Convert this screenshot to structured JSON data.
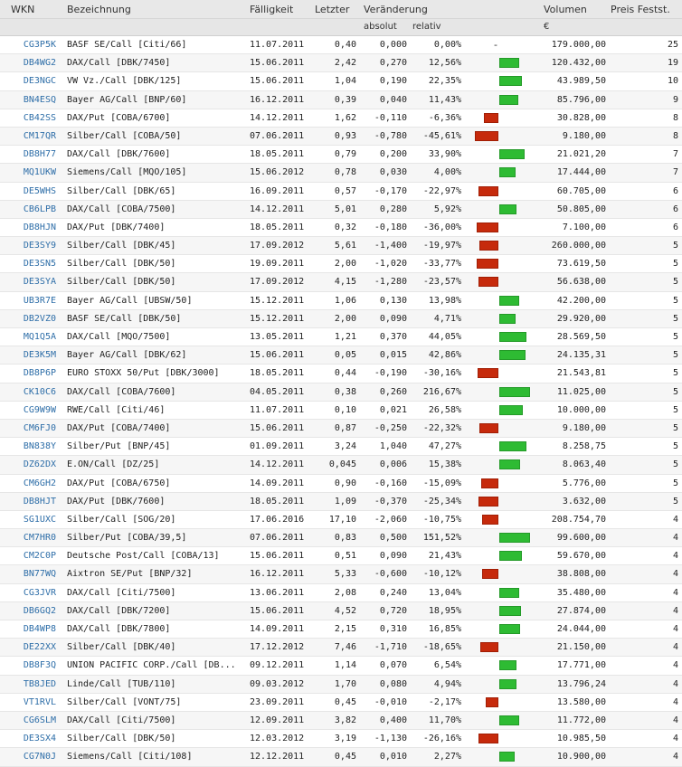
{
  "columns": {
    "wkn": "WKN",
    "bezeichnung": "Bezeichnung",
    "faelligkeit": "Fälligkeit",
    "letzter": "Letzter",
    "veraenderung": "Veränderung",
    "volumen": "Volumen",
    "preis": "Preis Festst.",
    "absolut": "absolut",
    "relativ": "relativ",
    "currency": "€"
  },
  "colors": {
    "positive": "#2ebb33",
    "negative": "#c62a0c",
    "link": "#2e6ea8"
  },
  "rows": [
    {
      "wkn": "CG3P5K",
      "bez": "BASF SE/Call [Citi/66]",
      "date": "11.07.2011",
      "last": "0,40",
      "abs": "0,000",
      "rel": "0,00%",
      "pct": 0.0,
      "vol": "179.000,00",
      "pre": "25"
    },
    {
      "wkn": "DB4WG2",
      "bez": "DAX/Call [DBK/7450]",
      "date": "15.06.2011",
      "last": "2,42",
      "abs": "0,270",
      "rel": "12,56%",
      "pct": 12.56,
      "vol": "120.432,00",
      "pre": "19"
    },
    {
      "wkn": "DE3NGC",
      "bez": "VW Vz./Call [DBK/125]",
      "date": "15.06.2011",
      "last": "1,04",
      "abs": "0,190",
      "rel": "22,35%",
      "pct": 22.35,
      "vol": "43.989,50",
      "pre": "10"
    },
    {
      "wkn": "BN4ESQ",
      "bez": "Bayer AG/Call [BNP/60]",
      "date": "16.12.2011",
      "last": "0,39",
      "abs": "0,040",
      "rel": "11,43%",
      "pct": 11.43,
      "vol": "85.796,00",
      "pre": "9"
    },
    {
      "wkn": "CB42SS",
      "bez": "DAX/Put [COBA/6700]",
      "date": "14.12.2011",
      "last": "1,62",
      "abs": "-0,110",
      "rel": "-6,36%",
      "pct": -6.36,
      "vol": "30.828,00",
      "pre": "8"
    },
    {
      "wkn": "CM17QR",
      "bez": "Silber/Call [COBA/50]",
      "date": "07.06.2011",
      "last": "0,93",
      "abs": "-0,780",
      "rel": "-45,61%",
      "pct": -45.61,
      "vol": "9.180,00",
      "pre": "8"
    },
    {
      "wkn": "DB8H77",
      "bez": "DAX/Call [DBK/7600]",
      "date": "18.05.2011",
      "last": "0,79",
      "abs": "0,200",
      "rel": "33,90%",
      "pct": 33.9,
      "vol": "21.021,20",
      "pre": "7"
    },
    {
      "wkn": "MQ1UKW",
      "bez": "Siemens/Call [MQO/105]",
      "date": "15.06.2012",
      "last": "0,78",
      "abs": "0,030",
      "rel": "4,00%",
      "pct": 4.0,
      "vol": "17.444,00",
      "pre": "7"
    },
    {
      "wkn": "DE5WHS",
      "bez": "Silber/Call [DBK/65]",
      "date": "16.09.2011",
      "last": "0,57",
      "abs": "-0,170",
      "rel": "-22,97%",
      "pct": -22.97,
      "vol": "60.705,00",
      "pre": "6"
    },
    {
      "wkn": "CB6LPB",
      "bez": "DAX/Call [COBA/7500]",
      "date": "14.12.2011",
      "last": "5,01",
      "abs": "0,280",
      "rel": "5,92%",
      "pct": 5.92,
      "vol": "50.805,00",
      "pre": "6"
    },
    {
      "wkn": "DB8HJN",
      "bez": "DAX/Put [DBK/7400]",
      "date": "18.05.2011",
      "last": "0,32",
      "abs": "-0,180",
      "rel": "-36,00%",
      "pct": -36.0,
      "vol": "7.100,00",
      "pre": "6"
    },
    {
      "wkn": "DE3SY9",
      "bez": "Silber/Call [DBK/45]",
      "date": "17.09.2012",
      "last": "5,61",
      "abs": "-1,400",
      "rel": "-19,97%",
      "pct": -19.97,
      "vol": "260.000,00",
      "pre": "5"
    },
    {
      "wkn": "DE3SN5",
      "bez": "Silber/Call [DBK/50]",
      "date": "19.09.2011",
      "last": "2,00",
      "abs": "-1,020",
      "rel": "-33,77%",
      "pct": -33.77,
      "vol": "73.619,50",
      "pre": "5"
    },
    {
      "wkn": "DE3SYA",
      "bez": "Silber/Call [DBK/50]",
      "date": "17.09.2012",
      "last": "4,15",
      "abs": "-1,280",
      "rel": "-23,57%",
      "pct": -23.57,
      "vol": "56.638,00",
      "pre": "5"
    },
    {
      "wkn": "UB3R7E",
      "bez": "Bayer AG/Call [UBSW/50]",
      "date": "15.12.2011",
      "last": "1,06",
      "abs": "0,130",
      "rel": "13,98%",
      "pct": 13.98,
      "vol": "42.200,00",
      "pre": "5"
    },
    {
      "wkn": "DB2VZ0",
      "bez": "BASF SE/Call [DBK/50]",
      "date": "15.12.2011",
      "last": "2,00",
      "abs": "0,090",
      "rel": "4,71%",
      "pct": 4.71,
      "vol": "29.920,00",
      "pre": "5"
    },
    {
      "wkn": "MQ1Q5A",
      "bez": "DAX/Call [MQO/7500]",
      "date": "13.05.2011",
      "last": "1,21",
      "abs": "0,370",
      "rel": "44,05%",
      "pct": 44.05,
      "vol": "28.569,50",
      "pre": "5"
    },
    {
      "wkn": "DE3K5M",
      "bez": "Bayer AG/Call [DBK/62]",
      "date": "15.06.2011",
      "last": "0,05",
      "abs": "0,015",
      "rel": "42,86%",
      "pct": 42.86,
      "vol": "24.135,31",
      "pre": "5"
    },
    {
      "wkn": "DB8P6P",
      "bez": "EURO STOXX 50/Put [DBK/3000]",
      "date": "18.05.2011",
      "last": "0,44",
      "abs": "-0,190",
      "rel": "-30,16%",
      "pct": -30.16,
      "vol": "21.543,81",
      "pre": "5"
    },
    {
      "wkn": "CK10C6",
      "bez": "DAX/Call [COBA/7600]",
      "date": "04.05.2011",
      "last": "0,38",
      "abs": "0,260",
      "rel": "216,67%",
      "pct": 216.67,
      "vol": "11.025,00",
      "pre": "5"
    },
    {
      "wkn": "CG9W9W",
      "bez": "RWE/Call [Citi/46]",
      "date": "11.07.2011",
      "last": "0,10",
      "abs": "0,021",
      "rel": "26,58%",
      "pct": 26.58,
      "vol": "10.000,00",
      "pre": "5"
    },
    {
      "wkn": "CM6FJ0",
      "bez": "DAX/Put [COBA/7400]",
      "date": "15.06.2011",
      "last": "0,87",
      "abs": "-0,250",
      "rel": "-22,32%",
      "pct": -22.32,
      "vol": "9.180,00",
      "pre": "5"
    },
    {
      "wkn": "BN838Y",
      "bez": "Silber/Put [BNP/45]",
      "date": "01.09.2011",
      "last": "3,24",
      "abs": "1,040",
      "rel": "47,27%",
      "pct": 47.27,
      "vol": "8.258,75",
      "pre": "5"
    },
    {
      "wkn": "DZ62DX",
      "bez": "E.ON/Call [DZ/25]",
      "date": "14.12.2011",
      "last": "0,045",
      "abs": "0,006",
      "rel": "15,38%",
      "pct": 15.38,
      "vol": "8.063,40",
      "pre": "5"
    },
    {
      "wkn": "CM6GH2",
      "bez": "DAX/Put [COBA/6750]",
      "date": "14.09.2011",
      "last": "0,90",
      "abs": "-0,160",
      "rel": "-15,09%",
      "pct": -15.09,
      "vol": "5.776,00",
      "pre": "5"
    },
    {
      "wkn": "DB8HJT",
      "bez": "DAX/Put [DBK/7600]",
      "date": "18.05.2011",
      "last": "1,09",
      "abs": "-0,370",
      "rel": "-25,34%",
      "pct": -25.34,
      "vol": "3.632,00",
      "pre": "5"
    },
    {
      "wkn": "SG1UXC",
      "bez": "Silber/Call [SOG/20]",
      "date": "17.06.2016",
      "last": "17,10",
      "abs": "-2,060",
      "rel": "-10,75%",
      "pct": -10.75,
      "vol": "208.754,70",
      "pre": "4"
    },
    {
      "wkn": "CM7HR0",
      "bez": "Silber/Put [COBA/39,5]",
      "date": "07.06.2011",
      "last": "0,83",
      "abs": "0,500",
      "rel": "151,52%",
      "pct": 151.52,
      "vol": "99.600,00",
      "pre": "4"
    },
    {
      "wkn": "CM2C0P",
      "bez": "Deutsche Post/Call [COBA/13]",
      "date": "15.06.2011",
      "last": "0,51",
      "abs": "0,090",
      "rel": "21,43%",
      "pct": 21.43,
      "vol": "59.670,00",
      "pre": "4"
    },
    {
      "wkn": "BN77WQ",
      "bez": "Aixtron SE/Put [BNP/32]",
      "date": "16.12.2011",
      "last": "5,33",
      "abs": "-0,600",
      "rel": "-10,12%",
      "pct": -10.12,
      "vol": "38.808,00",
      "pre": "4"
    },
    {
      "wkn": "CG3JVR",
      "bez": "DAX/Call [Citi/7500]",
      "date": "13.06.2011",
      "last": "2,08",
      "abs": "0,240",
      "rel": "13,04%",
      "pct": 13.04,
      "vol": "35.480,00",
      "pre": "4"
    },
    {
      "wkn": "DB6GQ2",
      "bez": "DAX/Call [DBK/7200]",
      "date": "15.06.2011",
      "last": "4,52",
      "abs": "0,720",
      "rel": "18,95%",
      "pct": 18.95,
      "vol": "27.874,00",
      "pre": "4"
    },
    {
      "wkn": "DB4WP8",
      "bez": "DAX/Call [DBK/7800]",
      "date": "14.09.2011",
      "last": "2,15",
      "abs": "0,310",
      "rel": "16,85%",
      "pct": 16.85,
      "vol": "24.044,00",
      "pre": "4"
    },
    {
      "wkn": "DE22XX",
      "bez": "Silber/Call [DBK/40]",
      "date": "17.12.2012",
      "last": "7,46",
      "abs": "-1,710",
      "rel": "-18,65%",
      "pct": -18.65,
      "vol": "21.150,00",
      "pre": "4"
    },
    {
      "wkn": "DB8F3Q",
      "bez": "UNION PACIFIC CORP./Call [DB...",
      "date": "09.12.2011",
      "last": "1,14",
      "abs": "0,070",
      "rel": "6,54%",
      "pct": 6.54,
      "vol": "17.771,00",
      "pre": "4"
    },
    {
      "wkn": "TB8JED",
      "bez": "Linde/Call [TUB/110]",
      "date": "09.03.2012",
      "last": "1,70",
      "abs": "0,080",
      "rel": "4,94%",
      "pct": 4.94,
      "vol": "13.796,24",
      "pre": "4"
    },
    {
      "wkn": "VT1RVL",
      "bez": "Silber/Call [VONT/75]",
      "date": "23.09.2011",
      "last": "0,45",
      "abs": "-0,010",
      "rel": "-2,17%",
      "pct": -2.17,
      "vol": "13.580,00",
      "pre": "4"
    },
    {
      "wkn": "CG6SLM",
      "bez": "DAX/Call [Citi/7500]",
      "date": "12.09.2011",
      "last": "3,82",
      "abs": "0,400",
      "rel": "11,70%",
      "pct": 11.7,
      "vol": "11.772,00",
      "pre": "4"
    },
    {
      "wkn": "DE3SX4",
      "bez": "Silber/Call [DBK/50]",
      "date": "12.03.2012",
      "last": "3,19",
      "abs": "-1,130",
      "rel": "-26,16%",
      "pct": -26.16,
      "vol": "10.985,50",
      "pre": "4"
    },
    {
      "wkn": "CG7N0J",
      "bez": "Siemens/Call [Citi/108]",
      "date": "12.12.2011",
      "last": "0,45",
      "abs": "0,010",
      "rel": "2,27%",
      "pct": 2.27,
      "vol": "10.900,00",
      "pre": "4"
    }
  ]
}
